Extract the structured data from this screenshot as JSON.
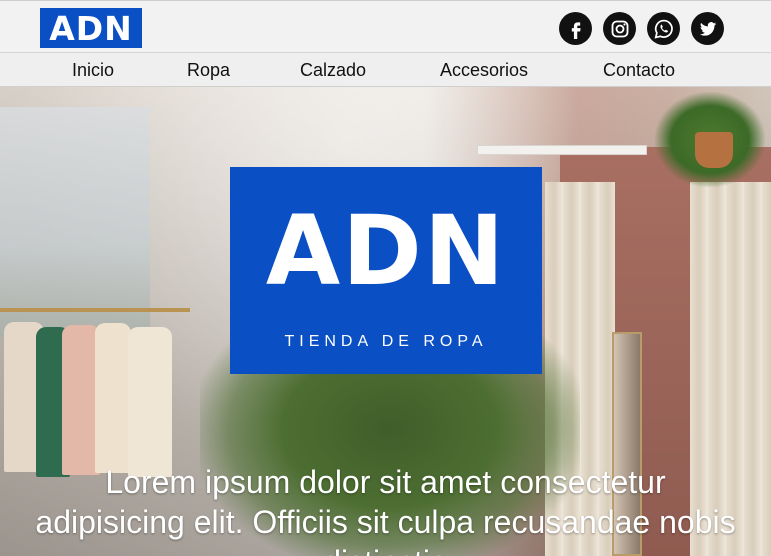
{
  "header": {
    "logo_text": "ADN",
    "brand_color": "#0b4fc4",
    "socials": [
      {
        "name": "facebook-icon"
      },
      {
        "name": "instagram-icon"
      },
      {
        "name": "whatsapp-icon"
      },
      {
        "name": "twitter-icon"
      }
    ]
  },
  "nav": {
    "items": [
      {
        "label": "Inicio"
      },
      {
        "label": "Ropa"
      },
      {
        "label": "Calzado"
      },
      {
        "label": "Accesorios"
      },
      {
        "label": "Contacto"
      }
    ]
  },
  "hero": {
    "logo_text": "ADN",
    "logo_subtitle": "TIENDA DE ROPA",
    "text": "Lorem ipsum dolor sit amet consectetur adipisicing elit. Officiis sit culpa recusandae nobis distinctio"
  }
}
